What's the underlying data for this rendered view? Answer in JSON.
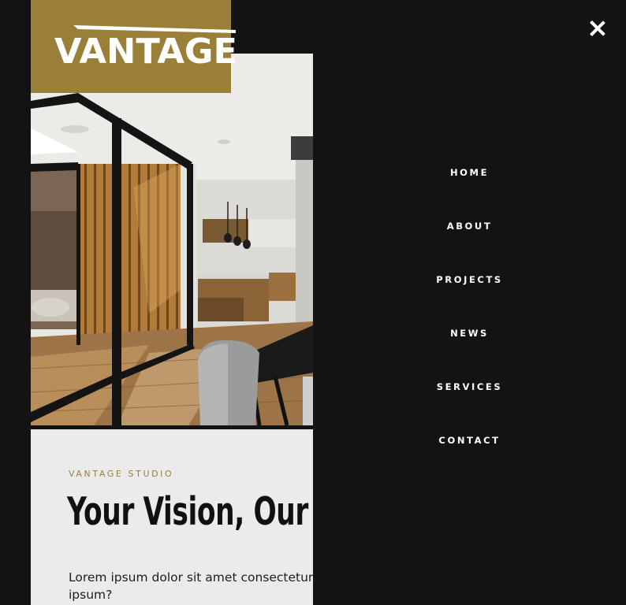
{
  "brand": {
    "logo_text": "VANTAGE",
    "logo_bg": "#9a7f38"
  },
  "hero": {
    "photo": "modern-interior-photo",
    "eyebrow": "VANTAGE STUDIO",
    "headline": "Your Vision, Our",
    "body": "Lorem ipsum dolor sit amet consectetur a saepe ipsum?"
  },
  "menu": {
    "close_icon": "close-icon",
    "items": [
      {
        "label": "HOME"
      },
      {
        "label": "ABOUT"
      },
      {
        "label": "PROJECTS"
      },
      {
        "label": "NEWS"
      },
      {
        "label": "SERVICES"
      },
      {
        "label": "CONTACT"
      }
    ]
  },
  "colors": {
    "accent": "#9a7f38",
    "panel": "#131313",
    "card": "#ebebeb",
    "text_light": "#ffffff"
  }
}
